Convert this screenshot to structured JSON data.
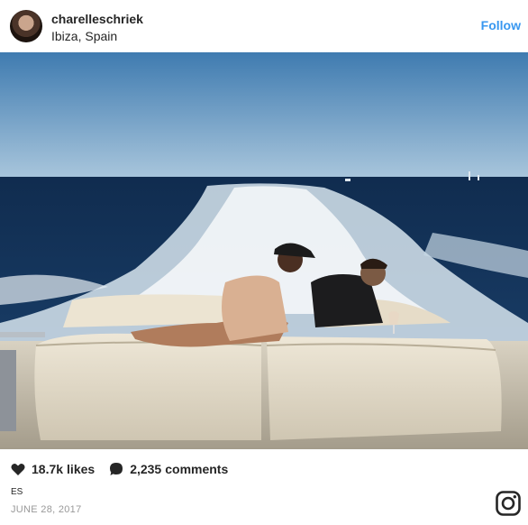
{
  "header": {
    "username": "charelleschriek",
    "location": "Ibiza, Spain",
    "follow_label": "Follow"
  },
  "photo": {
    "badge_icon": "user-tag-icon"
  },
  "stats": {
    "likes_count": "18.7k",
    "likes_label": "likes",
    "comments_count": "2,235",
    "comments_label": "comments"
  },
  "caption": "ES",
  "date": "JUNE 28, 2017",
  "colors": {
    "accent": "#3897f0",
    "text": "#262626",
    "muted": "#999999"
  }
}
